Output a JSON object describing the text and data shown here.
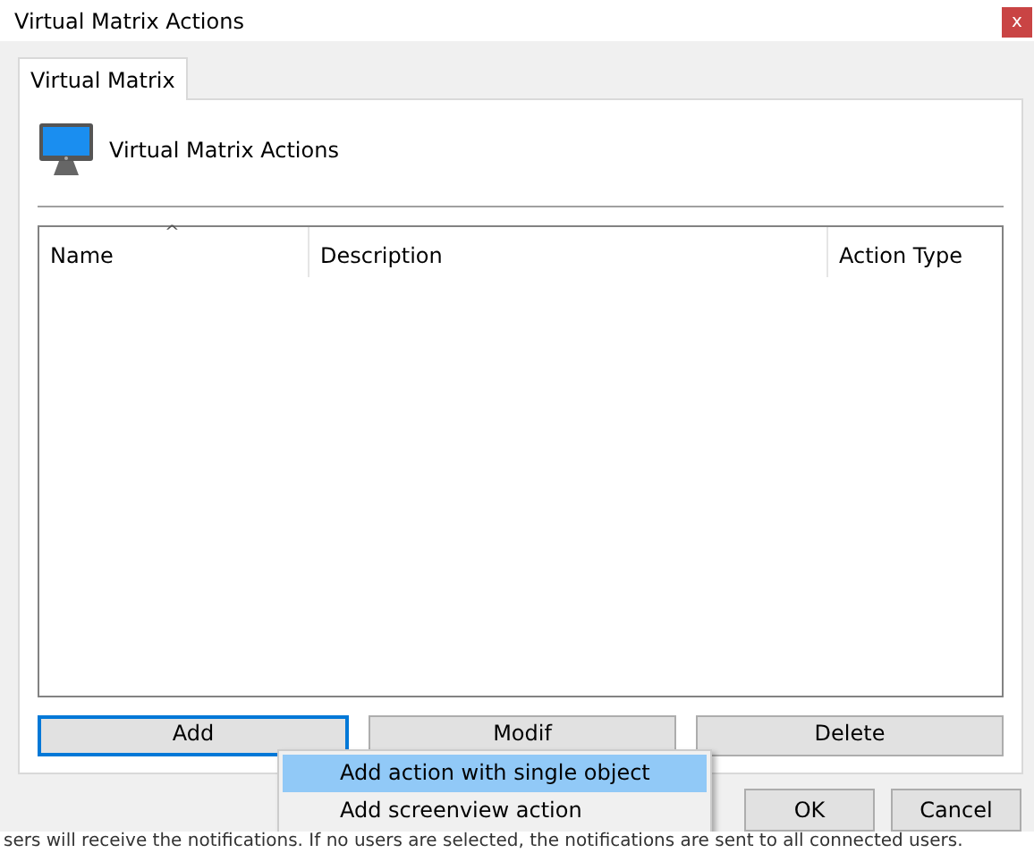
{
  "window": {
    "title": "Virtual Matrix Actions",
    "close": "x"
  },
  "tabs": [
    {
      "label": "Virtual Matrix",
      "selected": true
    }
  ],
  "header": {
    "title": "Virtual Matrix Actions"
  },
  "table": {
    "columns": [
      {
        "label": "Name",
        "sorted": true
      },
      {
        "label": "Description",
        "sorted": false
      },
      {
        "label": "Action Type",
        "sorted": false
      }
    ],
    "sort_glyph": "^"
  },
  "buttons": [
    {
      "label": "Add",
      "focused": true
    },
    {
      "label": "Modif",
      "focused": false
    },
    {
      "label": "Delete",
      "focused": false
    }
  ],
  "menu": [
    {
      "label": "Add action with single object",
      "selected": true
    },
    {
      "label": "Add screenview action",
      "selected": false
    }
  ],
  "dialog_buttons": [
    "OK",
    "Cancel"
  ],
  "background_text": "sers will receive the notifications. If no users are selected, the notifications are sent to all connected users."
}
